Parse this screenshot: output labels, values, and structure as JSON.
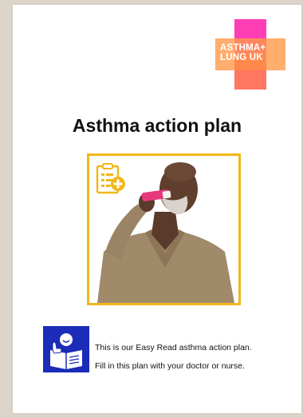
{
  "logo": {
    "line1": "ASTHMA+",
    "line2": "LUNG UK",
    "colors": {
      "pink": "#ff1ba8",
      "orange": "#ff9a4a"
    }
  },
  "title": "Asthma action plan",
  "photo": {
    "frame_color": "#f1b719",
    "icon": "clipboard-plus-icon"
  },
  "easy_read": {
    "icon": "easy-read-icon",
    "bg_color": "#1b2cb8",
    "line1": "This is our Easy Read asthma action plan.",
    "line2": "Fill in this plan with your doctor or nurse."
  }
}
